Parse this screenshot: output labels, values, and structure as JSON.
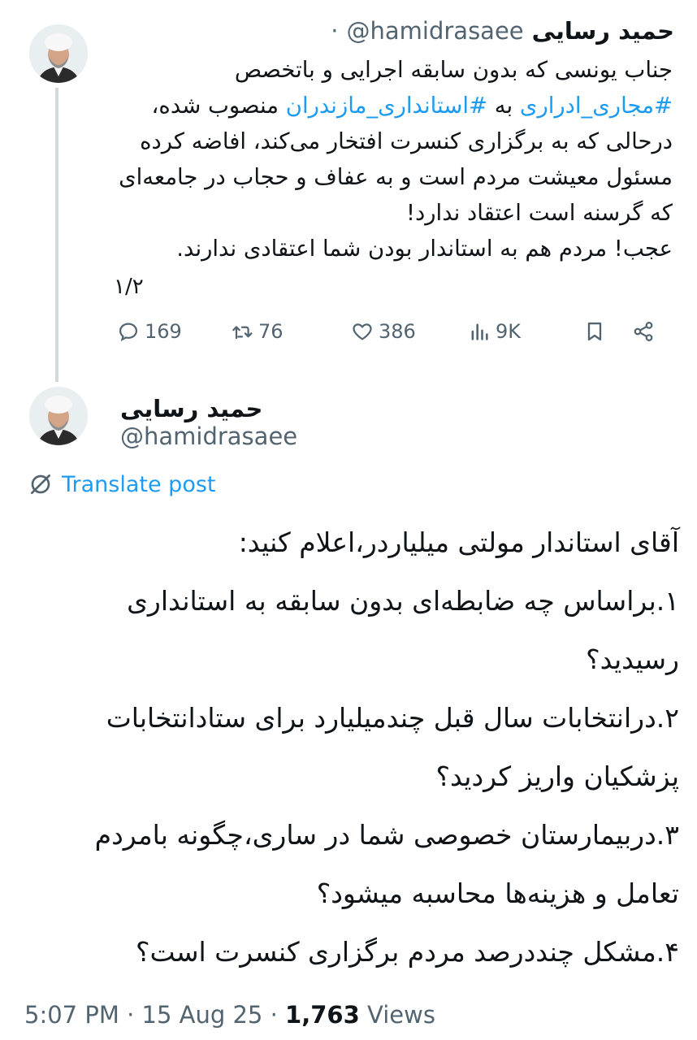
{
  "tweet1": {
    "author_name": "حمید رسایی",
    "handle": "@hamidrasaee",
    "separator": "·",
    "lines": [
      {
        "text": "جناب یونسی که بدون سابقه اجرایی و باتخصص"
      },
      {
        "pre": "",
        "hashtag1": "#مجاری_ادراری",
        "mid": " به ",
        "hashtag2": "#استانداری_مازندران",
        "post": " منصوب شده،"
      },
      {
        "text": "درحالی که به برگزاری کنسرت افتخار می‌کند، افاضه کرده"
      },
      {
        "text": "مسئول معیشت مردم است و به عفاف و حجاب در جامعه‌ای"
      },
      {
        "text": "که گرسنه است اعتقاد ندارد!"
      },
      {
        "text": "عجب! مردم هم به استاندار بودن شما اعتقادی ندارند."
      }
    ],
    "thread_counter": "۱/۲",
    "actions": {
      "replies": "169",
      "reposts": "76",
      "likes": "386",
      "views": "9K"
    }
  },
  "tweet2": {
    "author_name": "حمید رسایی",
    "handle": "@hamidrasaee",
    "translate_label": "Translate post",
    "paragraphs": [
      "آقای استاندار مولتی میلیاردر،اعلام کنید:",
      "۱.براساس چه ضابطه‌ای بدون سابقه به استانداری رسیدید؟",
      "۲.درانتخابات سال قبل چندمیلیارد برای ستادانتخابات پزشکیان واریز کردید؟",
      "۳.دربیمارستان خصوصی شما در ساری،چگونه بامردم تعامل و هزینه‌ها محاسبه میشود؟",
      "۴.مشکل چنددرصد مردم برگزاری کنسرت است؟"
    ],
    "meta": {
      "time": "5:07 PM",
      "sep1": " · ",
      "date": "15 Aug 25",
      "sep2": " · ",
      "views_count": "1,763",
      "views_label": " Views"
    }
  },
  "icons": {
    "reply": "comment-icon",
    "repost": "repost-icon",
    "like": "heart-icon",
    "views": "bar-chart-icon",
    "bookmark": "bookmark-icon",
    "share": "share-icon",
    "translate": "globe-slash-icon"
  },
  "colors": {
    "accent": "#1d9bf0",
    "text": "#0f1419",
    "secondary": "#536471",
    "thread_line": "#cfd9de"
  }
}
